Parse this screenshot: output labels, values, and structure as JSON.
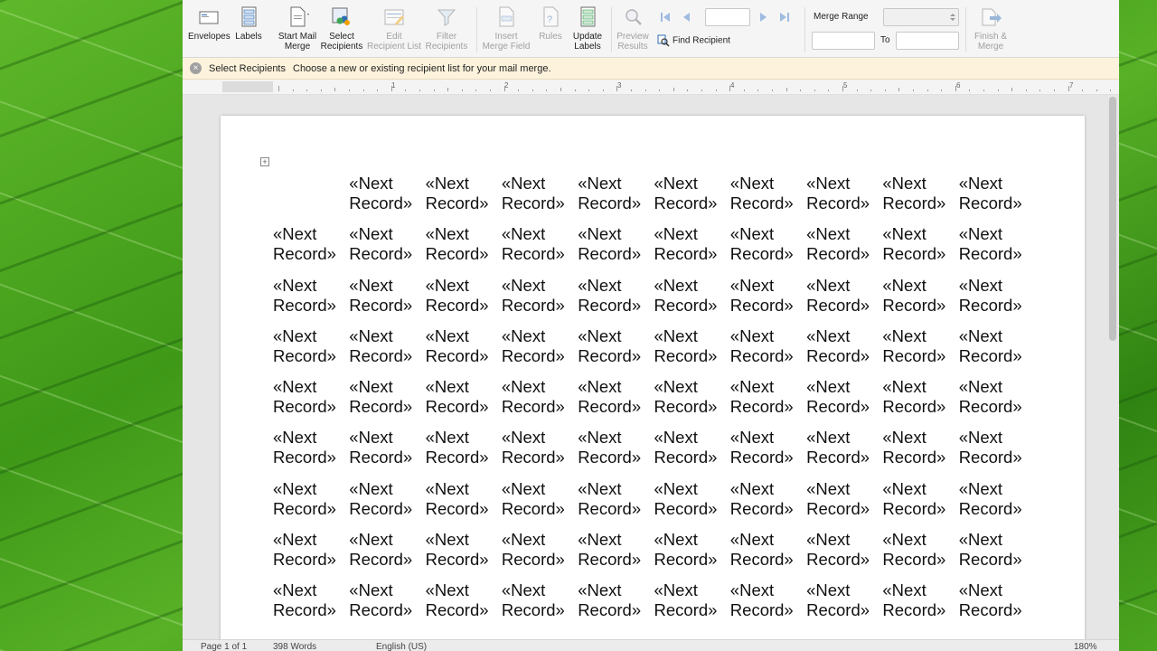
{
  "ribbon": {
    "envelopes": "Envelopes",
    "labels": "Labels",
    "start_mail_merge": [
      "Start Mail",
      "Merge"
    ],
    "select_recipients": [
      "Select",
      "Recipients"
    ],
    "edit_recipient_list": [
      "Edit",
      "Recipient List"
    ],
    "filter_recipients": [
      "Filter",
      "Recipients"
    ],
    "insert_merge_field": [
      "Insert",
      "Merge Field"
    ],
    "rules": "Rules",
    "update_labels": [
      "Update",
      "Labels"
    ],
    "preview_results": [
      "Preview",
      "Results"
    ],
    "find_recipient": "Find Recipient",
    "merge_range": "Merge Range",
    "to": "To",
    "finish_merge": [
      "Finish &",
      "Merge"
    ]
  },
  "message_bar": {
    "title": "Select Recipients",
    "text": "Choose a new or existing recipient list for your mail merge."
  },
  "ruler": {
    "numbers": [
      "1",
      "2",
      "3",
      "4",
      "5",
      "6",
      "7"
    ]
  },
  "document": {
    "field_line1": "«Next",
    "field_line2": "Record»",
    "rows": 9,
    "cols": 10,
    "first_cell_empty": true
  },
  "status_bar": {
    "page": "Page 1 of 1",
    "words": "398 Words",
    "language": "English (US)",
    "zoom": "180%"
  },
  "colors": {
    "ribbon_bg": "#f5f5f5",
    "message_bar_bg": "#fdf3dc",
    "accent_blue": "#2f6db5"
  }
}
